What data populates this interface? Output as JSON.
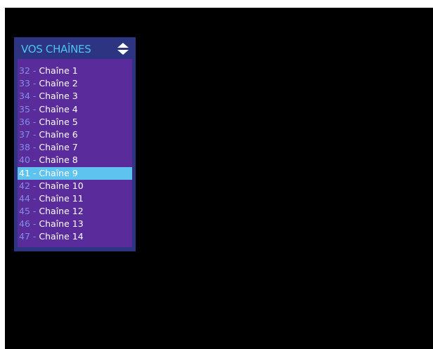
{
  "panel": {
    "title": "VOS CHAÎNES",
    "sort_icon": "up-down-arrows-icon"
  },
  "colors": {
    "background": "#000000",
    "panel_frame": "#2d3583",
    "list_background": "#5a2b9a",
    "title": "#4fc3f0",
    "selection": "#5fc3ef",
    "channel_number": "#7f8fe0",
    "channel_name": "#ffffff"
  },
  "channels": [
    {
      "number": "32",
      "separator": "-",
      "name": "Chaîne 1",
      "selected": false
    },
    {
      "number": "33",
      "separator": "-",
      "name": "Chaîne 2",
      "selected": false
    },
    {
      "number": "34",
      "separator": "-",
      "name": "Chaîne 3",
      "selected": false
    },
    {
      "number": "35",
      "separator": "-",
      "name": "Chaîne 4",
      "selected": false
    },
    {
      "number": "36",
      "separator": "-",
      "name": "Chaîne 5",
      "selected": false
    },
    {
      "number": "37",
      "separator": "-",
      "name": "Chaîne 6",
      "selected": false
    },
    {
      "number": "38",
      "separator": "-",
      "name": "Chaîne 7",
      "selected": false
    },
    {
      "number": "40",
      "separator": "-",
      "name": "Chaîne 8",
      "selected": false
    },
    {
      "number": "41",
      "separator": "-",
      "name": "Chaîne 9",
      "selected": true
    },
    {
      "number": "42",
      "separator": "-",
      "name": "Chaîne 10",
      "selected": false
    },
    {
      "number": "44",
      "separator": "-",
      "name": "Chaîne 11",
      "selected": false
    },
    {
      "number": "45",
      "separator": "-",
      "name": "Chaîne 12",
      "selected": false
    },
    {
      "number": "46",
      "separator": "-",
      "name": "Chaîne 13",
      "selected": false
    },
    {
      "number": "47",
      "separator": "-",
      "name": "Chaîne 14",
      "selected": false
    }
  ]
}
